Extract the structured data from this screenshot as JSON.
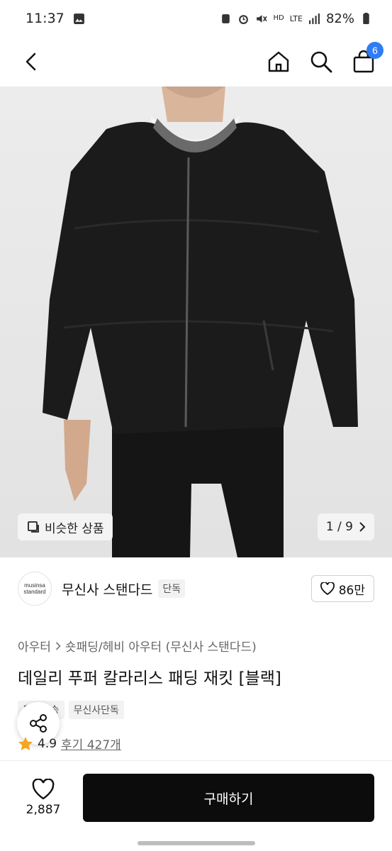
{
  "status_bar": {
    "time": "11:37",
    "network_hd": "HD",
    "network_lte": "LTE",
    "battery": "82%"
  },
  "header": {
    "back_icon": "chevron-left-icon",
    "home_icon": "home-icon",
    "search_icon": "search-icon",
    "cart_icon": "shopping-bag-icon",
    "cart_count": "6"
  },
  "image": {
    "similar_label": "비슷한 상품",
    "page_indicator": "1 / 9"
  },
  "brand": {
    "logo_line1": "musinsa",
    "logo_line2": "standard",
    "name": "무신사 스탠다드",
    "tag": "단독",
    "likes": "86만"
  },
  "breadcrumb": {
    "category": "아우터",
    "subcategory": "숏패딩/헤비 아우터 (무신사 스탠다드)"
  },
  "product": {
    "title": "데일리 푸퍼 칼라리스 패딩 재킷 [블랙]",
    "tags": [
      "무료배송",
      "무신사단독"
    ],
    "rating": "4.9",
    "reviews": "후기 427개"
  },
  "bottom": {
    "wish_count": "2,887",
    "buy_label": "구매하기"
  },
  "colors": {
    "accent": "#2f7cf6",
    "star": "#f5a623",
    "buy_button": "#0c0c0c"
  }
}
